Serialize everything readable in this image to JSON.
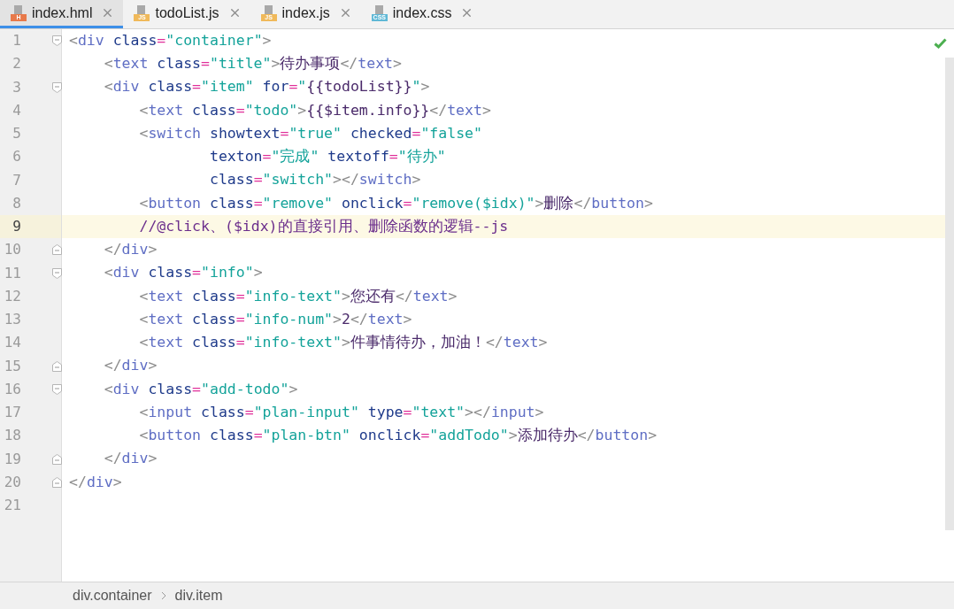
{
  "tabs": [
    {
      "label": "index.hml",
      "icon": {
        "kind": "html",
        "text": "H"
      },
      "selected": true
    },
    {
      "label": "todoList.js",
      "icon": {
        "kind": "js",
        "text": "JS"
      },
      "selected": false
    },
    {
      "label": "index.js",
      "icon": {
        "kind": "js",
        "text": "JS"
      },
      "selected": false
    },
    {
      "label": "index.css",
      "icon": {
        "kind": "css",
        "text": "CSS"
      },
      "selected": false
    }
  ],
  "status": {
    "ok": true
  },
  "lines": [
    {
      "number": "1",
      "kind": "fold-start",
      "highlighted": false,
      "tokens": [
        {
          "kind": "punct",
          "text": "<"
        },
        {
          "kind": "tag",
          "text": "div "
        },
        {
          "kind": "attr",
          "text": "class"
        },
        {
          "kind": "eq",
          "text": "="
        },
        {
          "kind": "str",
          "text": "\"container\""
        },
        {
          "kind": "punct",
          "text": ">"
        }
      ]
    },
    {
      "number": "2",
      "kind": "plain",
      "highlighted": false,
      "tokens": [
        {
          "kind": "punct",
          "text": "    <"
        },
        {
          "kind": "tag",
          "text": "text "
        },
        {
          "kind": "attr",
          "text": "class"
        },
        {
          "kind": "eq",
          "text": "="
        },
        {
          "kind": "str",
          "text": "\"title\""
        },
        {
          "kind": "punct",
          "text": ">"
        },
        {
          "kind": "text",
          "text": "待办事项"
        },
        {
          "kind": "punct",
          "text": "</"
        },
        {
          "kind": "tag",
          "text": "text"
        },
        {
          "kind": "punct",
          "text": ">"
        }
      ]
    },
    {
      "number": "3",
      "kind": "fold-start",
      "highlighted": false,
      "tokens": [
        {
          "kind": "punct",
          "text": "    <"
        },
        {
          "kind": "tag",
          "text": "div "
        },
        {
          "kind": "attr",
          "text": "class"
        },
        {
          "kind": "eq",
          "text": "="
        },
        {
          "kind": "str",
          "text": "\"item\" "
        },
        {
          "kind": "attr",
          "text": "for"
        },
        {
          "kind": "eq",
          "text": "="
        },
        {
          "kind": "str",
          "text": "\""
        },
        {
          "kind": "text",
          "text": "{{todoList}}"
        },
        {
          "kind": "str",
          "text": "\""
        },
        {
          "kind": "punct",
          "text": ">"
        }
      ]
    },
    {
      "number": "4",
      "kind": "plain",
      "highlighted": false,
      "tokens": [
        {
          "kind": "punct",
          "text": "        <"
        },
        {
          "kind": "tag",
          "text": "text "
        },
        {
          "kind": "attr",
          "text": "class"
        },
        {
          "kind": "eq",
          "text": "="
        },
        {
          "kind": "str",
          "text": "\"todo\""
        },
        {
          "kind": "punct",
          "text": ">"
        },
        {
          "kind": "text",
          "text": "{{$item.info}}"
        },
        {
          "kind": "punct",
          "text": "</"
        },
        {
          "kind": "tag",
          "text": "text"
        },
        {
          "kind": "punct",
          "text": ">"
        }
      ]
    },
    {
      "number": "5",
      "kind": "plain",
      "highlighted": false,
      "tokens": [
        {
          "kind": "punct",
          "text": "        <"
        },
        {
          "kind": "tag",
          "text": "switch "
        },
        {
          "kind": "attr",
          "text": "showtext"
        },
        {
          "kind": "eq",
          "text": "="
        },
        {
          "kind": "str",
          "text": "\"true\" "
        },
        {
          "kind": "attr",
          "text": "checked"
        },
        {
          "kind": "eq",
          "text": "="
        },
        {
          "kind": "str",
          "text": "\"false\""
        }
      ]
    },
    {
      "number": "6",
      "kind": "plain",
      "highlighted": false,
      "tokens": [
        {
          "kind": "attr",
          "text": "                texton"
        },
        {
          "kind": "eq",
          "text": "="
        },
        {
          "kind": "str",
          "text": "\"完成\" "
        },
        {
          "kind": "attr",
          "text": "textoff"
        },
        {
          "kind": "eq",
          "text": "="
        },
        {
          "kind": "str",
          "text": "\"待办\""
        }
      ]
    },
    {
      "number": "7",
      "kind": "plain",
      "highlighted": false,
      "tokens": [
        {
          "kind": "attr",
          "text": "                class"
        },
        {
          "kind": "eq",
          "text": "="
        },
        {
          "kind": "str",
          "text": "\"switch\""
        },
        {
          "kind": "punct",
          "text": "></"
        },
        {
          "kind": "tag",
          "text": "switch"
        },
        {
          "kind": "punct",
          "text": ">"
        }
      ]
    },
    {
      "number": "8",
      "kind": "plain",
      "highlighted": false,
      "tokens": [
        {
          "kind": "punct",
          "text": "        <"
        },
        {
          "kind": "tag",
          "text": "button "
        },
        {
          "kind": "attr",
          "text": "class"
        },
        {
          "kind": "eq",
          "text": "="
        },
        {
          "kind": "str",
          "text": "\"remove\" "
        },
        {
          "kind": "attr",
          "text": "onclick"
        },
        {
          "kind": "eq",
          "text": "="
        },
        {
          "kind": "str",
          "text": "\"remove($idx)\""
        },
        {
          "kind": "punct",
          "text": ">"
        },
        {
          "kind": "text",
          "text": "删除"
        },
        {
          "kind": "punct",
          "text": "</"
        },
        {
          "kind": "tag",
          "text": "button"
        },
        {
          "kind": "punct",
          "text": ">"
        }
      ]
    },
    {
      "number": "9",
      "kind": "plain",
      "highlighted": true,
      "tokens": [
        {
          "kind": "comment",
          "text": "        //@click、($idx)的直接引用、删除函数的逻辑--js"
        }
      ]
    },
    {
      "number": "10",
      "kind": "fold-end",
      "highlighted": false,
      "tokens": [
        {
          "kind": "punct",
          "text": "    </"
        },
        {
          "kind": "tag",
          "text": "div"
        },
        {
          "kind": "punct",
          "text": ">"
        }
      ]
    },
    {
      "number": "11",
      "kind": "fold-start",
      "highlighted": false,
      "tokens": [
        {
          "kind": "punct",
          "text": "    <"
        },
        {
          "kind": "tag",
          "text": "div "
        },
        {
          "kind": "attr",
          "text": "class"
        },
        {
          "kind": "eq",
          "text": "="
        },
        {
          "kind": "str",
          "text": "\"info\""
        },
        {
          "kind": "punct",
          "text": ">"
        }
      ]
    },
    {
      "number": "12",
      "kind": "plain",
      "highlighted": false,
      "tokens": [
        {
          "kind": "punct",
          "text": "        <"
        },
        {
          "kind": "tag",
          "text": "text "
        },
        {
          "kind": "attr",
          "text": "class"
        },
        {
          "kind": "eq",
          "text": "="
        },
        {
          "kind": "str",
          "text": "\"info-text\""
        },
        {
          "kind": "punct",
          "text": ">"
        },
        {
          "kind": "text",
          "text": "您还有"
        },
        {
          "kind": "punct",
          "text": "</"
        },
        {
          "kind": "tag",
          "text": "text"
        },
        {
          "kind": "punct",
          "text": ">"
        }
      ]
    },
    {
      "number": "13",
      "kind": "plain",
      "highlighted": false,
      "tokens": [
        {
          "kind": "punct",
          "text": "        <"
        },
        {
          "kind": "tag",
          "text": "text "
        },
        {
          "kind": "attr",
          "text": "class"
        },
        {
          "kind": "eq",
          "text": "="
        },
        {
          "kind": "str",
          "text": "\"info-num\""
        },
        {
          "kind": "punct",
          "text": ">"
        },
        {
          "kind": "text",
          "text": "2"
        },
        {
          "kind": "punct",
          "text": "</"
        },
        {
          "kind": "tag",
          "text": "text"
        },
        {
          "kind": "punct",
          "text": ">"
        }
      ]
    },
    {
      "number": "14",
      "kind": "plain",
      "highlighted": false,
      "tokens": [
        {
          "kind": "punct",
          "text": "        <"
        },
        {
          "kind": "tag",
          "text": "text "
        },
        {
          "kind": "attr",
          "text": "class"
        },
        {
          "kind": "eq",
          "text": "="
        },
        {
          "kind": "str",
          "text": "\"info-text\""
        },
        {
          "kind": "punct",
          "text": ">"
        },
        {
          "kind": "text",
          "text": "件事情待办，加油！"
        },
        {
          "kind": "punct",
          "text": "</"
        },
        {
          "kind": "tag",
          "text": "text"
        },
        {
          "kind": "punct",
          "text": ">"
        }
      ]
    },
    {
      "number": "15",
      "kind": "fold-end",
      "highlighted": false,
      "tokens": [
        {
          "kind": "punct",
          "text": "    </"
        },
        {
          "kind": "tag",
          "text": "div"
        },
        {
          "kind": "punct",
          "text": ">"
        }
      ]
    },
    {
      "number": "16",
      "kind": "fold-start",
      "highlighted": false,
      "tokens": [
        {
          "kind": "punct",
          "text": "    <"
        },
        {
          "kind": "tag",
          "text": "div "
        },
        {
          "kind": "attr",
          "text": "class"
        },
        {
          "kind": "eq",
          "text": "="
        },
        {
          "kind": "str",
          "text": "\"add-todo\""
        },
        {
          "kind": "punct",
          "text": ">"
        }
      ]
    },
    {
      "number": "17",
      "kind": "plain",
      "highlighted": false,
      "tokens": [
        {
          "kind": "punct",
          "text": "        <"
        },
        {
          "kind": "tag",
          "text": "input "
        },
        {
          "kind": "attr",
          "text": "class"
        },
        {
          "kind": "eq",
          "text": "="
        },
        {
          "kind": "str",
          "text": "\"plan-input\" "
        },
        {
          "kind": "attr",
          "text": "type"
        },
        {
          "kind": "eq",
          "text": "="
        },
        {
          "kind": "str",
          "text": "\"text\""
        },
        {
          "kind": "punct",
          "text": "></"
        },
        {
          "kind": "tag",
          "text": "input"
        },
        {
          "kind": "punct",
          "text": ">"
        }
      ]
    },
    {
      "number": "18",
      "kind": "plain",
      "highlighted": false,
      "tokens": [
        {
          "kind": "punct",
          "text": "        <"
        },
        {
          "kind": "tag",
          "text": "button "
        },
        {
          "kind": "attr",
          "text": "class"
        },
        {
          "kind": "eq",
          "text": "="
        },
        {
          "kind": "str",
          "text": "\"plan-btn\" "
        },
        {
          "kind": "attr",
          "text": "onclick"
        },
        {
          "kind": "eq",
          "text": "="
        },
        {
          "kind": "str",
          "text": "\"addTodo\""
        },
        {
          "kind": "punct",
          "text": ">"
        },
        {
          "kind": "text",
          "text": "添加待办"
        },
        {
          "kind": "punct",
          "text": "</"
        },
        {
          "kind": "tag",
          "text": "button"
        },
        {
          "kind": "punct",
          "text": ">"
        }
      ]
    },
    {
      "number": "19",
      "kind": "fold-end",
      "highlighted": false,
      "tokens": [
        {
          "kind": "punct",
          "text": "    </"
        },
        {
          "kind": "tag",
          "text": "div"
        },
        {
          "kind": "punct",
          "text": ">"
        }
      ]
    },
    {
      "number": "20",
      "kind": "fold-end",
      "highlighted": false,
      "tokens": [
        {
          "kind": "punct",
          "text": "</"
        },
        {
          "kind": "tag",
          "text": "div"
        },
        {
          "kind": "punct",
          "text": ">"
        }
      ]
    },
    {
      "number": "21",
      "kind": "plain",
      "highlighted": false
    }
  ],
  "breadcrumbs": [
    "div.container",
    "div.item"
  ]
}
